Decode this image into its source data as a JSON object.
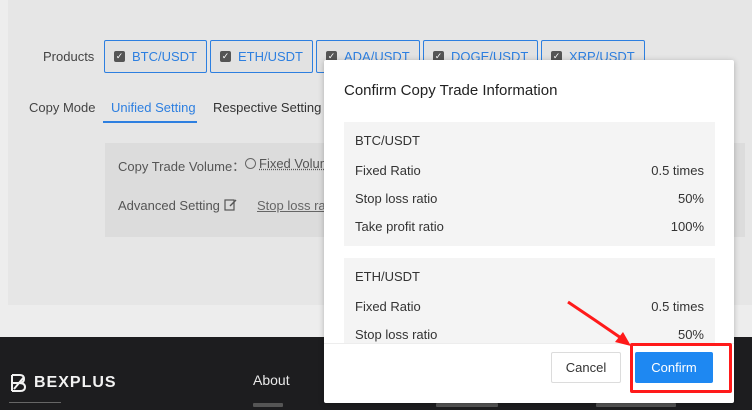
{
  "products": {
    "label": "Products",
    "items": [
      {
        "label": "BTC/USDT"
      },
      {
        "label": "ETH/USDT"
      },
      {
        "label": "ADA/USDT"
      },
      {
        "label": "DOGE/USDT"
      },
      {
        "label": "XRP/USDT"
      }
    ]
  },
  "copy_mode": {
    "label": "Copy Mode",
    "tabs": [
      {
        "label": "Unified Setting",
        "active": true
      },
      {
        "label": "Respective Setting",
        "active": false
      }
    ]
  },
  "settings": {
    "volume_label": "Copy Trade Volume：",
    "volume_option": "Fixed Volume",
    "advanced_label": "Advanced Setting",
    "stoploss_link": "Stop loss ratio"
  },
  "modal": {
    "title": "Confirm Copy Trade Information",
    "sections": [
      {
        "pair": "BTC/USDT",
        "rows": [
          {
            "label": "Fixed Ratio",
            "value": "0.5 times"
          },
          {
            "label": "Stop loss ratio",
            "value": "50%"
          },
          {
            "label": "Take profit ratio",
            "value": "100%"
          }
        ]
      },
      {
        "pair": "ETH/USDT",
        "rows": [
          {
            "label": "Fixed Ratio",
            "value": "0.5 times"
          },
          {
            "label": "Stop loss ratio",
            "value": "50%"
          }
        ]
      }
    ],
    "cancel_label": "Cancel",
    "confirm_label": "Confirm"
  },
  "footer": {
    "brand": "BEXPLUS",
    "about": "About"
  },
  "colors": {
    "accent": "#2d7fe0",
    "confirm": "#1e88f2",
    "annotation": "#ff1a1a",
    "footer_bg": "#1d1d1f"
  },
  "icons": [
    "checkbox-checked-icon",
    "radio-icon",
    "edit-icon",
    "bexplus-logo-icon",
    "annotation-arrow-icon"
  ]
}
